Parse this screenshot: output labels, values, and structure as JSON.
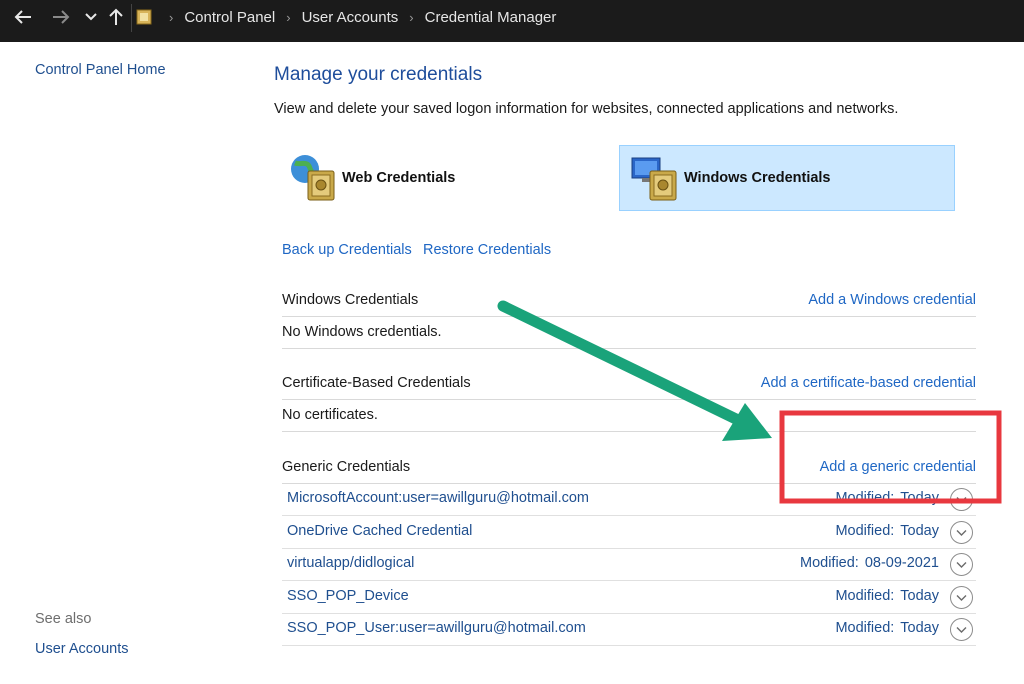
{
  "breadcrumb": [
    "Control Panel",
    "User Accounts",
    "Credential Manager"
  ],
  "left_nav": {
    "home": "Control Panel Home",
    "see_also": "See also",
    "user_accounts": "User Accounts"
  },
  "main": {
    "title": "Manage your credentials",
    "description": "View and delete your saved logon information for websites, connected applications and networks.",
    "web_tile": "Web Credentials",
    "windows_tile": "Windows Credentials",
    "backup_link": "Back up Credentials",
    "restore_link": "Restore Credentials"
  },
  "sections": {
    "windows": {
      "title": "Windows Credentials",
      "add_link": "Add a Windows credential",
      "empty": "No Windows credentials."
    },
    "certificate": {
      "title": "Certificate-Based Credentials",
      "add_link": "Add a certificate-based credential",
      "empty": "No certificates."
    },
    "generic": {
      "title": "Generic Credentials",
      "add_link": "Add a generic credential",
      "items": [
        {
          "name": "MicrosoftAccount:user=awillguru@hotmail.com",
          "modified_label": "Modified:",
          "modified": "Today"
        },
        {
          "name": "OneDrive Cached Credential",
          "modified_label": "Modified:",
          "modified": "Today"
        },
        {
          "name": "virtualapp/didlogical",
          "modified_label": "Modified:",
          "modified": "08-09-2021"
        },
        {
          "name": "SSO_POP_Device",
          "modified_label": "Modified:",
          "modified": "Today"
        },
        {
          "name": "SSO_POP_User:user=awillguru@hotmail.com",
          "modified_label": "Modified:",
          "modified": "Today"
        }
      ]
    }
  },
  "icons": {
    "back": "back-arrow-icon",
    "forward": "forward-arrow-icon",
    "recent": "chevron-down-icon",
    "up": "up-arrow-icon",
    "control_panel": "control-panel-icon",
    "web_credentials": "globe-vault-icon",
    "windows_credentials": "monitor-vault-icon",
    "expand": "chevron-down-circle-icon"
  },
  "colors": {
    "link": "#1f67c4",
    "title": "#1e4d9b",
    "selected_tile": "#cce8ff",
    "annotation_arrow": "#1aa37a",
    "annotation_box": "#e8383f"
  }
}
